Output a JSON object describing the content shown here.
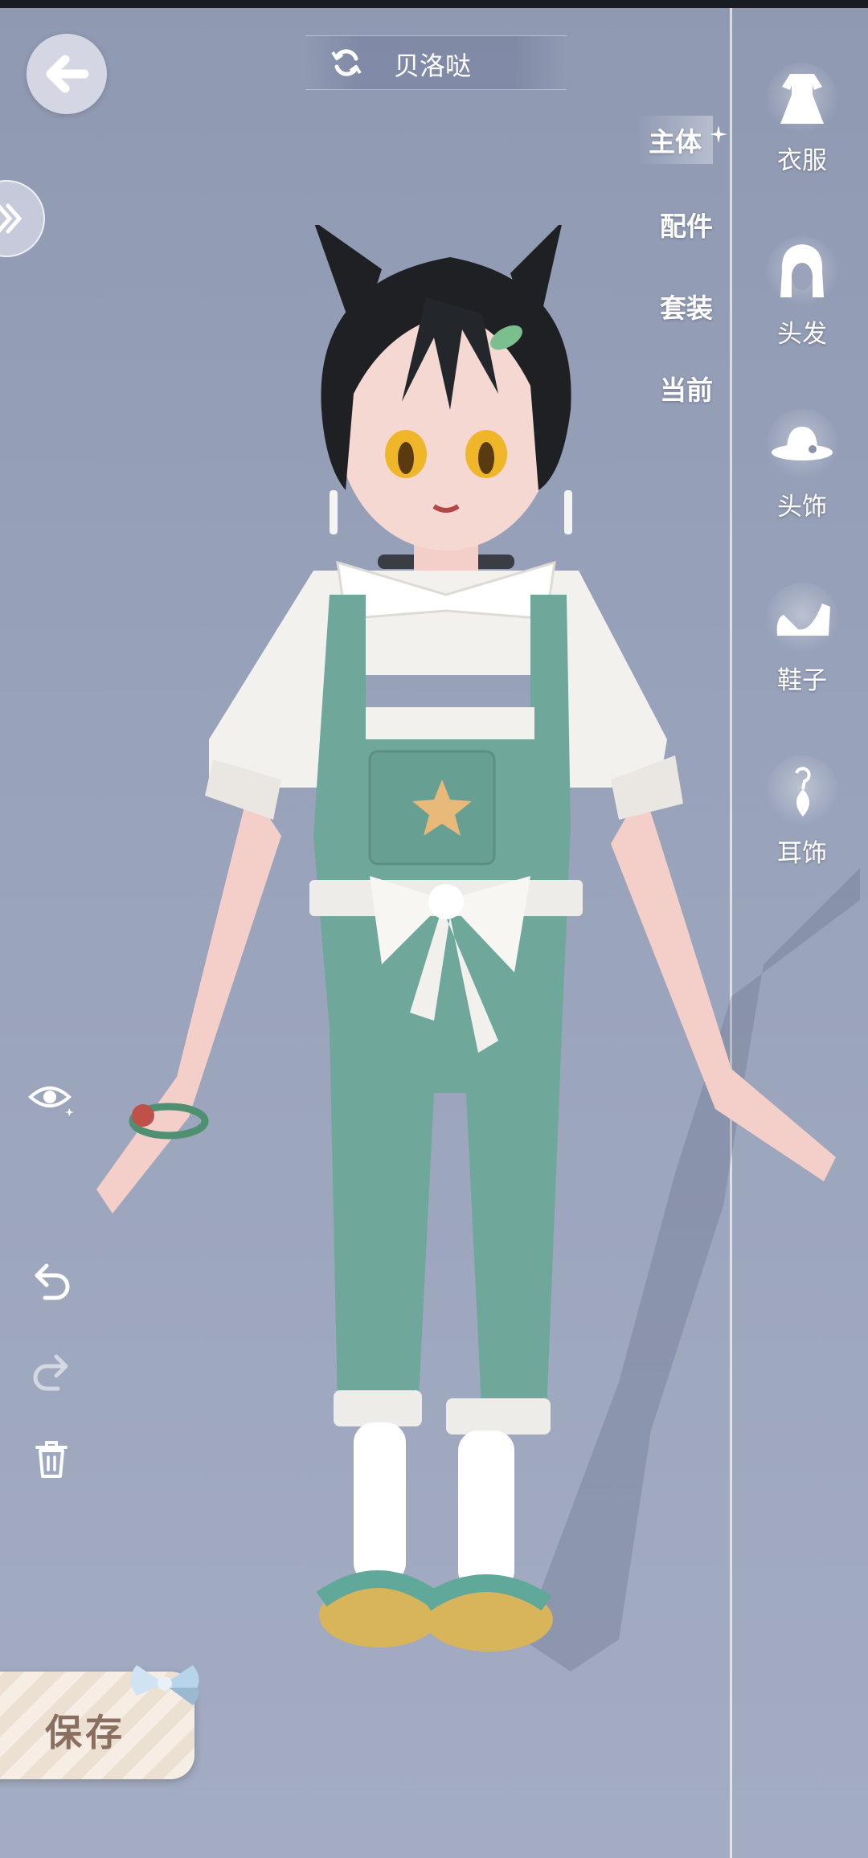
{
  "header": {
    "character_name": "贝洛哒"
  },
  "subcategories": [
    {
      "label": "主体",
      "active": true
    },
    {
      "label": "配件",
      "active": false
    },
    {
      "label": "套装",
      "active": false
    },
    {
      "label": "当前",
      "active": false
    }
  ],
  "categories": [
    {
      "label": "衣服",
      "icon": "dress-icon"
    },
    {
      "label": "头发",
      "icon": "hair-icon"
    },
    {
      "label": "头饰",
      "icon": "hat-icon"
    },
    {
      "label": "鞋子",
      "icon": "shoe-icon"
    },
    {
      "label": "耳饰",
      "icon": "earring-icon"
    }
  ],
  "actions": {
    "save_label": "保存"
  },
  "colors": {
    "overall_teal": "#6fa89b",
    "shirt_white": "#f3f1ee",
    "hair_black": "#1e2024",
    "eyes_gold": "#f0b62a"
  }
}
